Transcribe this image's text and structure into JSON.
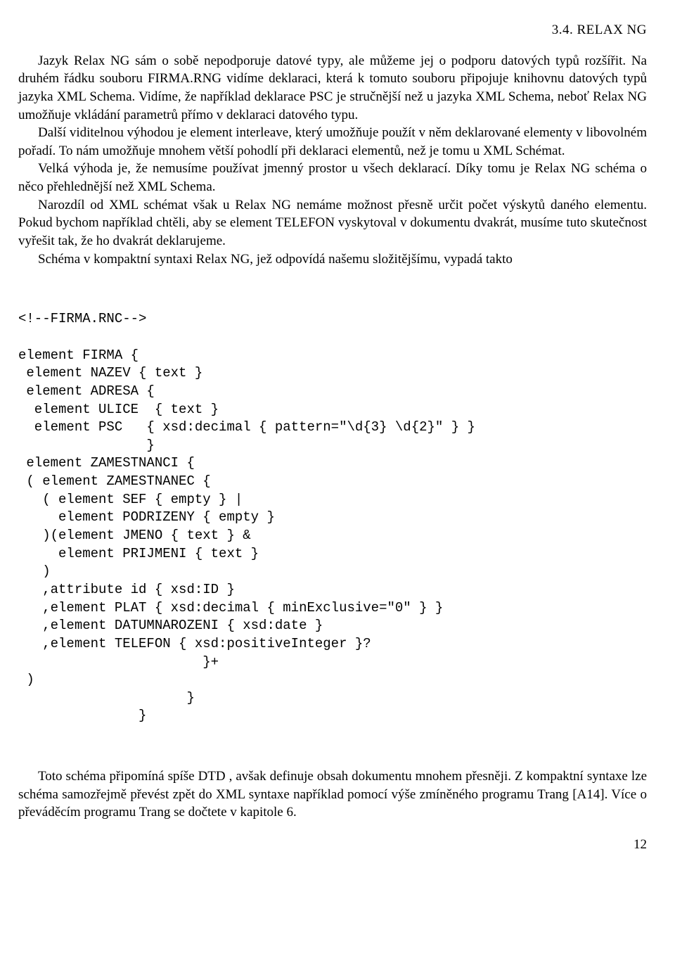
{
  "header": "3.4. RELAX NG",
  "body": {
    "p1a": "Jazyk Relax NG sám o sobě nepodporuje datové typy, ale můžeme jej o podporu dato­vých typů rozšířit. Na druhém řádku souboru FIRMA.RNG vidíme deklaraci, která k tomuto souboru připojuje knihovnu datových typů jazyka XML Schema. Vidíme, že například de­klarace PSC je stručnější než u jazyka XML Schema, neboť Relax NG umožňuje vkládání parametrů přímo v deklaraci datového typu.",
    "p2": "Další viditelnou výhodou je element interleave, který umožňuje použít v něm deklaro­vané elementy v libovolném pořadí. To nám umožňuje mnohem větší pohodlí při deklaraci elementů, než je tomu u XML Schémat.",
    "p3": "Velká výhoda je, že nemusíme používat jmenný prostor u všech deklarací. Díky tomu je Relax NG schéma o něco přehlednější než XML Schema.",
    "p4": "Narozdíl od XML schémat však u Relax NG nemáme možnost přesně určit počet výskytů daného elementu. Pokud bychom například chtěli, aby se element TELEFON vyskytoval v dokumentu dvakrát, musíme tuto skutečnost vyřešit tak, že ho dvakrát deklarujeme.",
    "p5": "Schéma v kompaktní syntaxi Relax NG, jež odpovídá našemu složitějšímu, vypadá takto",
    "p6": "Toto schéma připomíná spíše DTD , avšak definuje obsah dokumentu mnohem přesněji. Z kompaktní syntaxe lze schéma samozřejmě převést zpět do XML syntaxe například pomocí výše zmíněného programu Trang [A14]. Více o převáděcím programu Trang se dočtete v kapitole 6."
  },
  "code": "<!--FIRMA.RNC-->\n\nelement FIRMA {\n element NAZEV { text }\n element ADRESA {\n  element ULICE  { text }\n  element PSC   { xsd:decimal { pattern=\"\\d{3} \\d{2}\" } }\n                }\n element ZAMESTNANCI {\n ( element ZAMESTNANEC {\n   ( element SEF { empty } |\n     element PODRIZENY { empty }\n   )(element JMENO { text } &\n     element PRIJMENI { text }\n   )\n   ,attribute id { xsd:ID }\n   ,element PLAT { xsd:decimal { minExclusive=\"0\" } }\n   ,element DATUMNAROZENI { xsd:date }\n   ,element TELEFON { xsd:positiveInteger }?\n                       }+\n )\n                     }\n               }",
  "pageNumber": "12"
}
